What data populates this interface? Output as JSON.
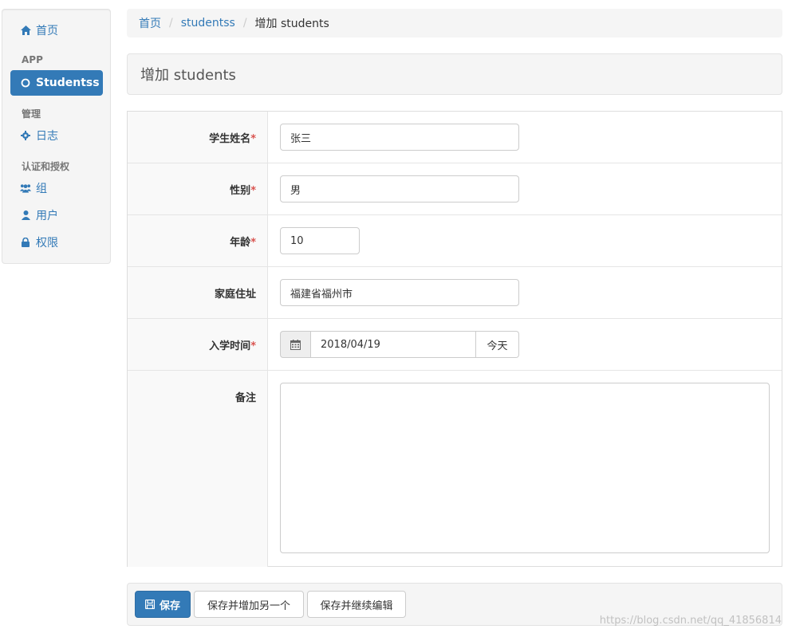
{
  "sidebar": {
    "home": "首页",
    "section_app": "APP",
    "studentss": "Studentss",
    "section_manage": "管理",
    "log": "日志",
    "section_auth": "认证和授权",
    "group": "组",
    "user": "用户",
    "permission": "权限"
  },
  "breadcrumb": {
    "home": "首页",
    "model": "studentss",
    "current": "增加 students"
  },
  "page": {
    "title": "增加 students"
  },
  "form": {
    "name_label": "学生姓名",
    "name_value": "张三",
    "gender_label": "性别",
    "gender_value": "男",
    "age_label": "年龄",
    "age_value": "10",
    "address_label": "家庭住址",
    "address_value": "福建省福州市",
    "enroll_label": "入学时间",
    "enroll_value": "2018/04/19",
    "today_button": "今天",
    "remark_label": "备注",
    "remark_value": "",
    "required_mark": "*"
  },
  "actions": {
    "save": "保存",
    "save_add": "保存并增加另一个",
    "save_continue": "保存并继续编辑"
  },
  "watermark": "https://blog.csdn.net/qq_41856814",
  "colors": {
    "primary": "#337ab7",
    "required": "#d9534f"
  }
}
